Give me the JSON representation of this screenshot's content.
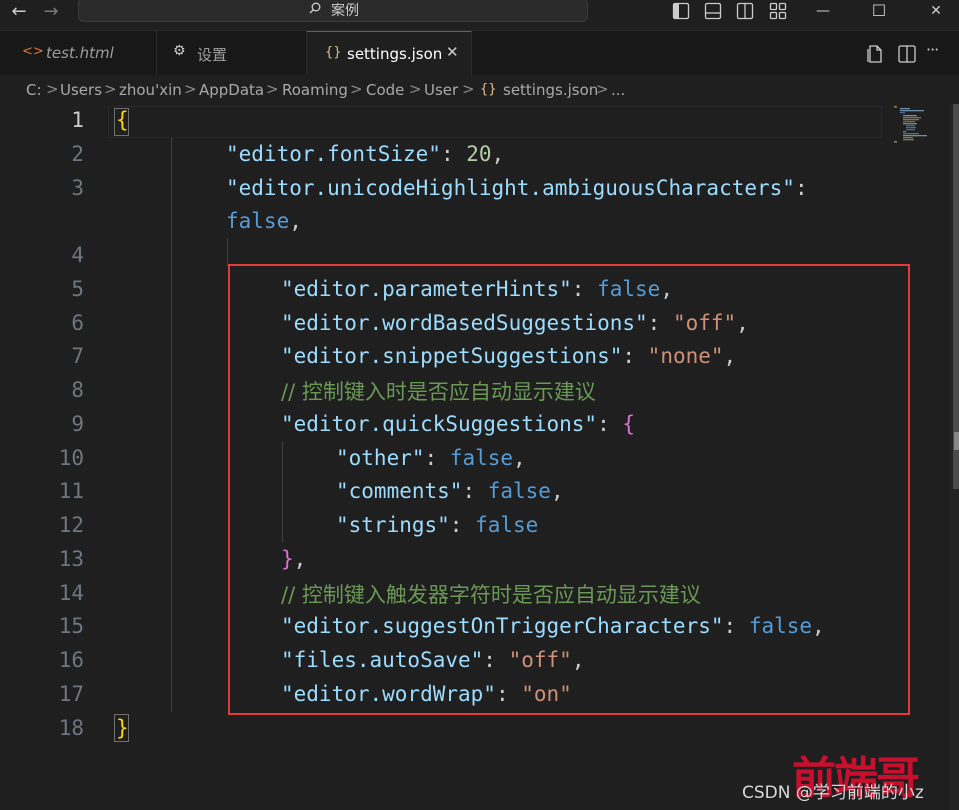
{
  "titlebar": {
    "back_glyph": "←",
    "forward_glyph": "→",
    "command_center_text": "案例",
    "icons": [
      "search-icon",
      "toggle-primary-sidebar-icon",
      "toggle-panel-icon",
      "toggle-secondary-sidebar-icon",
      "customize-layout-icon"
    ],
    "minimize_glyph": "—",
    "maximize_glyph": "☐",
    "close_glyph": "✕"
  },
  "tabs": [
    {
      "icon": "<>",
      "label": "test.html",
      "active": false,
      "italic": true
    },
    {
      "icon": "⚙",
      "label": "设置",
      "active": false,
      "italic": false
    },
    {
      "icon": "{}",
      "label": "settings.json",
      "active": true,
      "italic": false,
      "close": "✕"
    }
  ],
  "tab_actions": [
    "open-changes-icon",
    "split-editor-icon",
    "more-actions-icon"
  ],
  "tab_more_glyph": "···",
  "breadcrumb": {
    "segments": [
      "C:",
      "Users",
      "zhou'xin",
      "AppData",
      "Roaming",
      "Code",
      "User",
      "settings.json",
      "..."
    ],
    "separator": ">",
    "file_icon": "{}"
  },
  "editor": {
    "line_numbers": [
      "1",
      "2",
      "3",
      "",
      "4",
      "5",
      "6",
      "7",
      "8",
      "9",
      "10",
      "11",
      "12",
      "13",
      "14",
      "15",
      "16",
      "17",
      "18"
    ],
    "current_line": "1",
    "lines": {
      "l1_brace": "{",
      "l2_key": "\"editor.fontSize\"",
      "l2_colon": ": ",
      "l2_val": "20",
      "l2_end": ",",
      "l3_key": "\"editor.unicodeHighlight.ambiguousCharacters\"",
      "l3_colon": ":",
      "l3b_val": "false",
      "l3b_end": ",",
      "l5_key": "\"editor.parameterHints\"",
      "l5_colon": ": ",
      "l5_val": "false",
      "l5_end": ",",
      "l6_key": "\"editor.wordBasedSuggestions\"",
      "l6_colon": ": ",
      "l6_val": "\"off\"",
      "l6_end": ",",
      "l7_key": "\"editor.snippetSuggestions\"",
      "l7_colon": ": ",
      "l7_val": "\"none\"",
      "l7_end": ",",
      "l8_comment": "// 控制键入时是否应自动显示建议",
      "l9_key": "\"editor.quickSuggestions\"",
      "l9_colon": ": ",
      "l9_brace": "{",
      "l10_key": "\"other\"",
      "l10_colon": ": ",
      "l10_val": "false",
      "l10_end": ",",
      "l11_key": "\"comments\"",
      "l11_colon": ": ",
      "l11_val": "false",
      "l11_end": ",",
      "l12_key": "\"strings\"",
      "l12_colon": ": ",
      "l12_val": "false",
      "l13_brace": "}",
      "l13_end": ",",
      "l14_comment": "// 控制键入触发器字符时是否应自动显示建议",
      "l15_key": "\"editor.suggestOnTriggerCharacters\"",
      "l15_colon": ": ",
      "l15_val": "false",
      "l15_end": ",",
      "l16_key": "\"files.autoSave\"",
      "l16_colon": ": ",
      "l16_val": "\"off\"",
      "l16_end": ",",
      "l17_key": "\"editor.wordWrap\"",
      "l17_colon": ": ",
      "l17_val": "\"on\"",
      "l18_brace": "}"
    }
  },
  "watermark": {
    "csdn": "CSDN @学习前端的小z",
    "brand": "前端哥"
  },
  "colors": {
    "key": "#9cdcfe",
    "string": "#ce9178",
    "boolean": "#569cd6",
    "number": "#b5cea8",
    "comment": "#6a9955",
    "bracket_level1": "#ffd700",
    "bracket_level2": "#da70d6",
    "highlight_rect": "#e43a3a",
    "active_tab_border": "#0078d4"
  }
}
